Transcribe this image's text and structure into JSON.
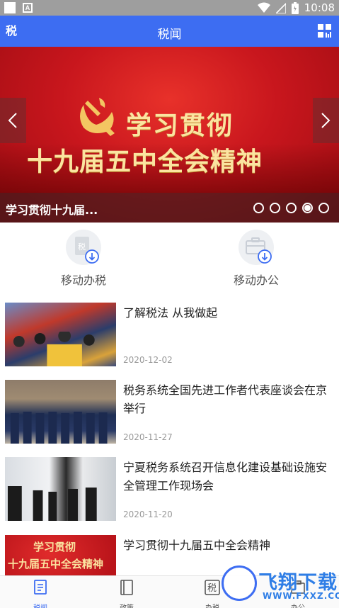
{
  "status_bar": {
    "time": "10:08"
  },
  "app_bar": {
    "title": "税闻",
    "logo_text": "税"
  },
  "banner": {
    "headline_line1": "学习贯彻",
    "headline_line2": "十九届五中全会精神",
    "caption": "学习贯彻十九届...",
    "slide_count": 5,
    "active_slide": 4
  },
  "quick_actions": [
    {
      "label": "移动办税",
      "icon": "tax-download-icon"
    },
    {
      "label": "移动办公",
      "icon": "briefcase-download-icon"
    }
  ],
  "news": [
    {
      "title": "了解税法 从我做起",
      "date": "2020-12-02"
    },
    {
      "title": "税务系统全国先进工作者代表座谈会在京举行",
      "date": "2020-11-27"
    },
    {
      "title": "宁夏税务系统召开信息化建设基础设施安全管理工作现场会",
      "date": "2020-11-20"
    },
    {
      "title": "学习贯彻十九届五中全会精神",
      "date": ""
    }
  ],
  "thumb4": {
    "line1": "学习贯彻",
    "line2": "十九届五中全会精神"
  },
  "bottom_nav": [
    {
      "label": "税闻",
      "active": true
    },
    {
      "label": "政策",
      "active": false
    },
    {
      "label": "办税",
      "active": false
    },
    {
      "label": "办公",
      "active": false
    }
  ],
  "watermark": {
    "text": "飞翔下载",
    "url": "WWW.FXXZ.COM"
  },
  "colors": {
    "primary": "#3d6df2",
    "banner_red": "#c8161d",
    "gold_text": "#fbe4a0"
  }
}
